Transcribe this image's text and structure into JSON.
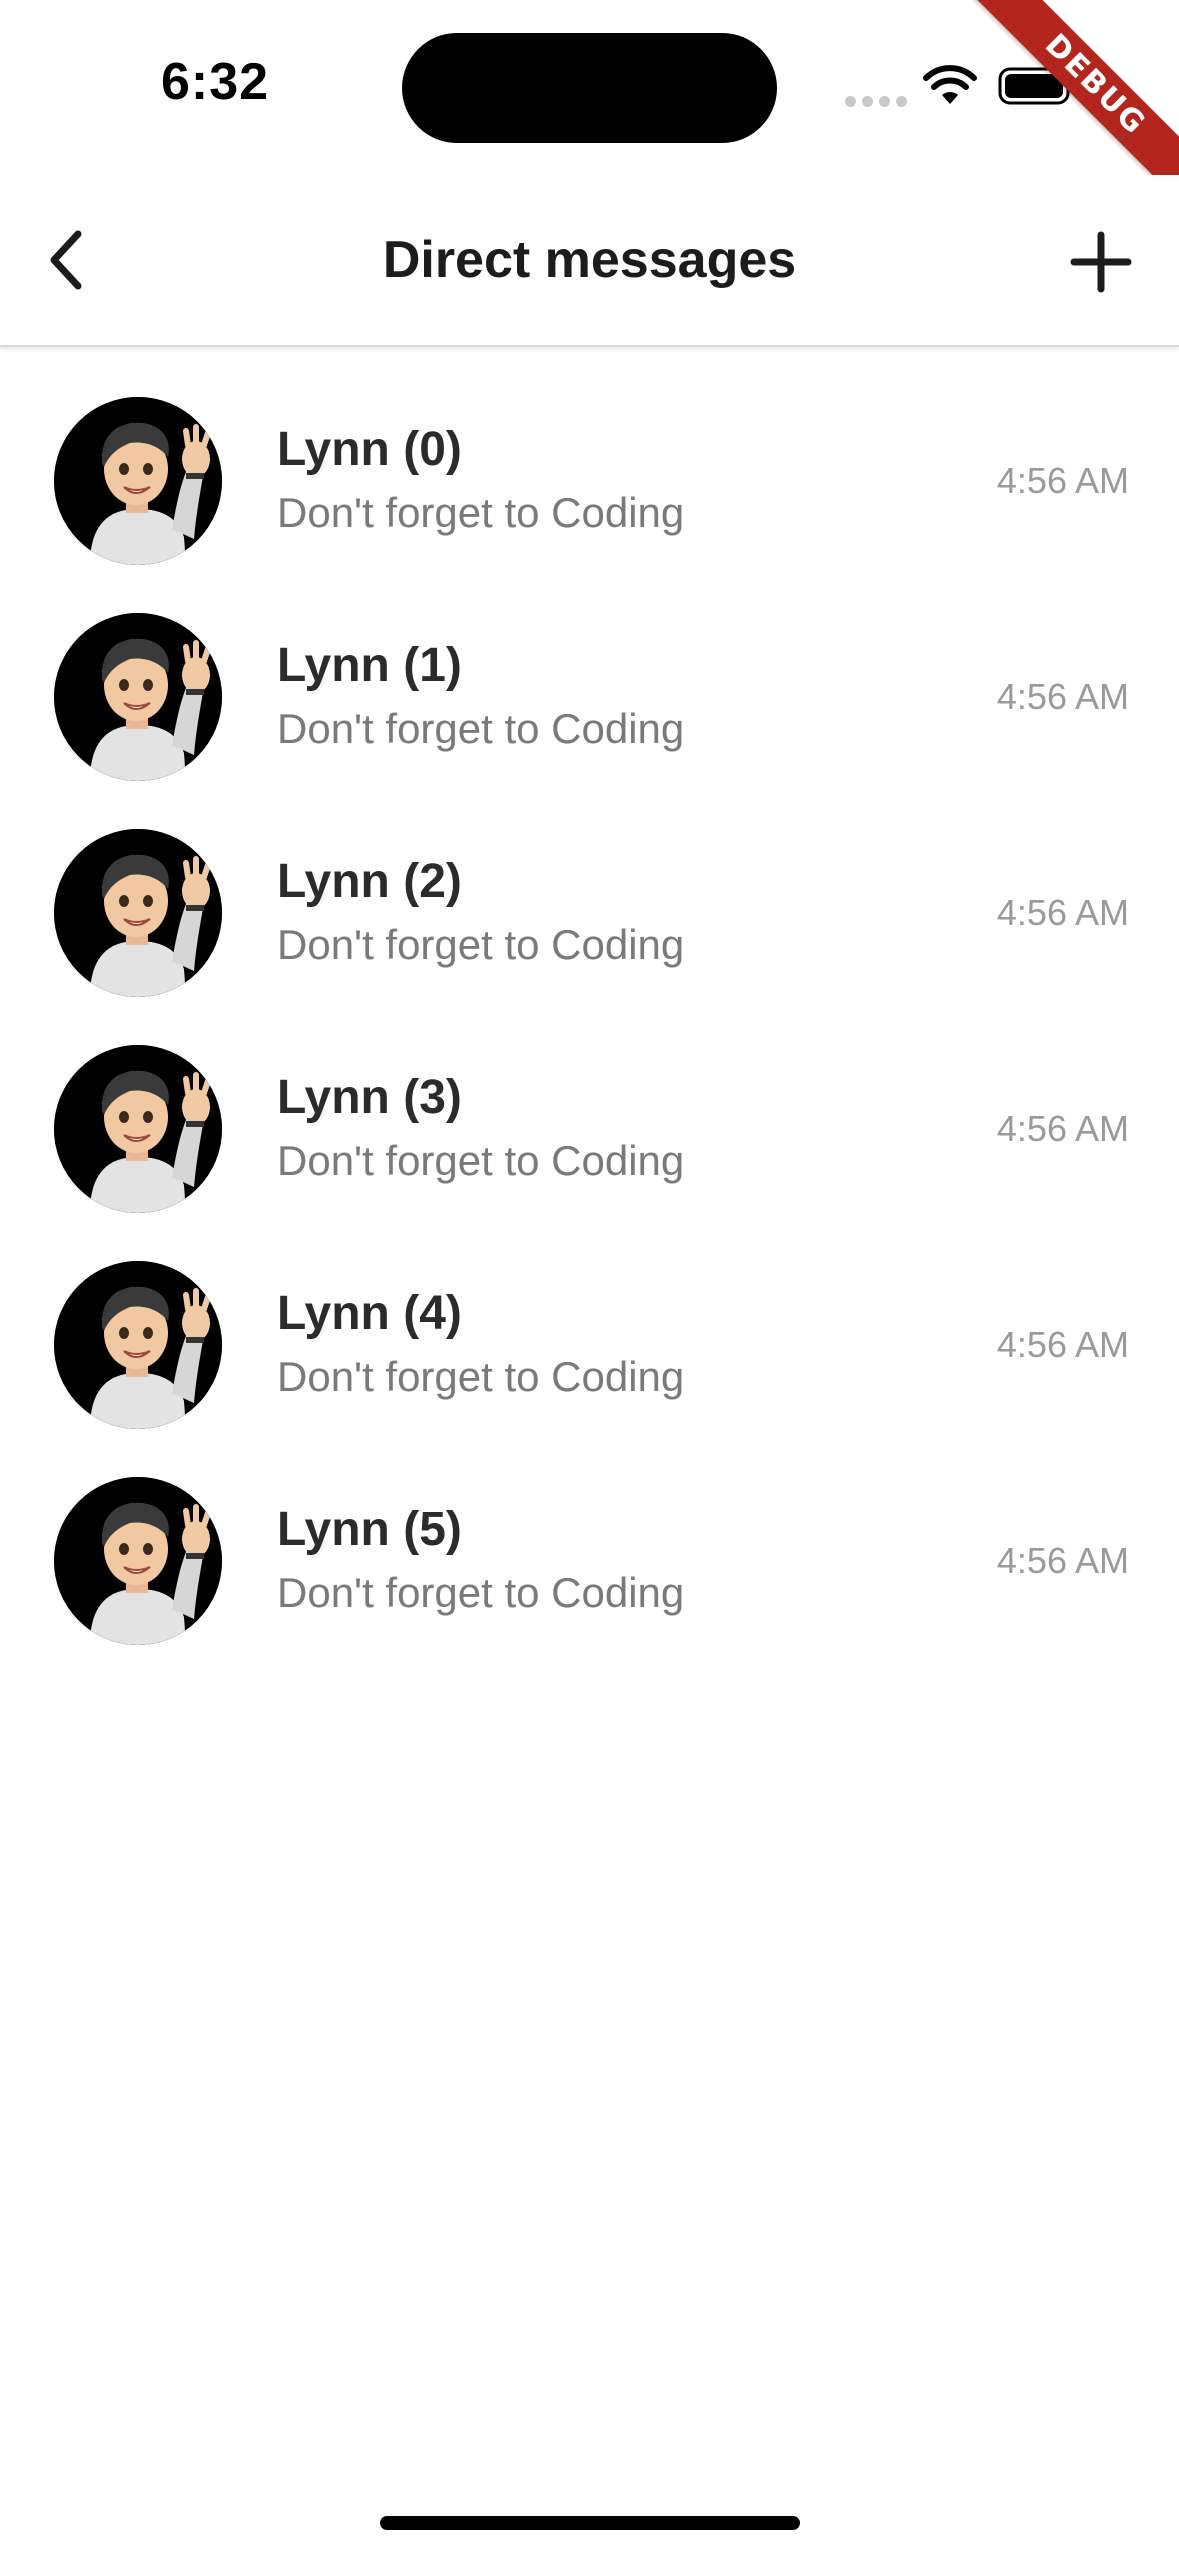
{
  "status_bar": {
    "time": "6:32"
  },
  "debug_banner": {
    "label": "DEBUG",
    "color": "#b3261e"
  },
  "nav": {
    "title": "Direct messages",
    "back_icon": "chevron-left-icon",
    "add_icon": "plus-icon"
  },
  "messages": [
    {
      "name": "Lynn (0)",
      "preview": "Don't forget to Coding",
      "time": "4:56 AM"
    },
    {
      "name": "Lynn (1)",
      "preview": "Don't forget to Coding",
      "time": "4:56 AM"
    },
    {
      "name": "Lynn (2)",
      "preview": "Don't forget to Coding",
      "time": "4:56 AM"
    },
    {
      "name": "Lynn (3)",
      "preview": "Don't forget to Coding",
      "time": "4:56 AM"
    },
    {
      "name": "Lynn (4)",
      "preview": "Don't forget to Coding",
      "time": "4:56 AM"
    },
    {
      "name": "Lynn (5)",
      "preview": "Don't forget to Coding",
      "time": "4:56 AM"
    }
  ]
}
